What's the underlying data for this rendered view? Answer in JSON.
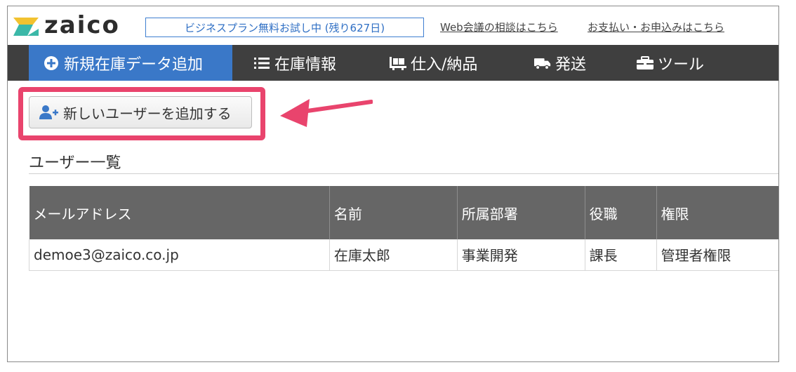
{
  "header": {
    "logo_text": "zaico",
    "trial_badge": "ビジネスプラン無料お試し中 (残り627日)",
    "web_meeting_link": "Web会議の相談はこちら",
    "payment_link": "お支払い・お申込みはこちら"
  },
  "nav": {
    "items": [
      {
        "label": "新規在庫データ追加",
        "icon": "plus-circle-icon"
      },
      {
        "label": "在庫情報",
        "icon": "list-icon"
      },
      {
        "label": "仕入/納品",
        "icon": "pallet-icon"
      },
      {
        "label": "発送",
        "icon": "truck-icon"
      },
      {
        "label": "ツール",
        "icon": "toolbox-icon"
      }
    ]
  },
  "add_user_button": {
    "label": "新しいユーザーを追加する",
    "icon": "user-plus-icon"
  },
  "user_list": {
    "title": "ユーザー一覧",
    "columns": [
      "メールアドレス",
      "名前",
      "所属部署",
      "役職",
      "権限"
    ],
    "rows": [
      [
        "demoe3@zaico.co.jp",
        "在庫太郎",
        "事業開発",
        "課長",
        "管理者権限"
      ]
    ]
  },
  "colors": {
    "nav_bg": "#3f3f3f",
    "nav_active": "#3a78c8",
    "highlight": "#e9446d",
    "table_header": "#666666",
    "logo_yellow": "#f2c230",
    "logo_teal": "#3bb8a8"
  }
}
